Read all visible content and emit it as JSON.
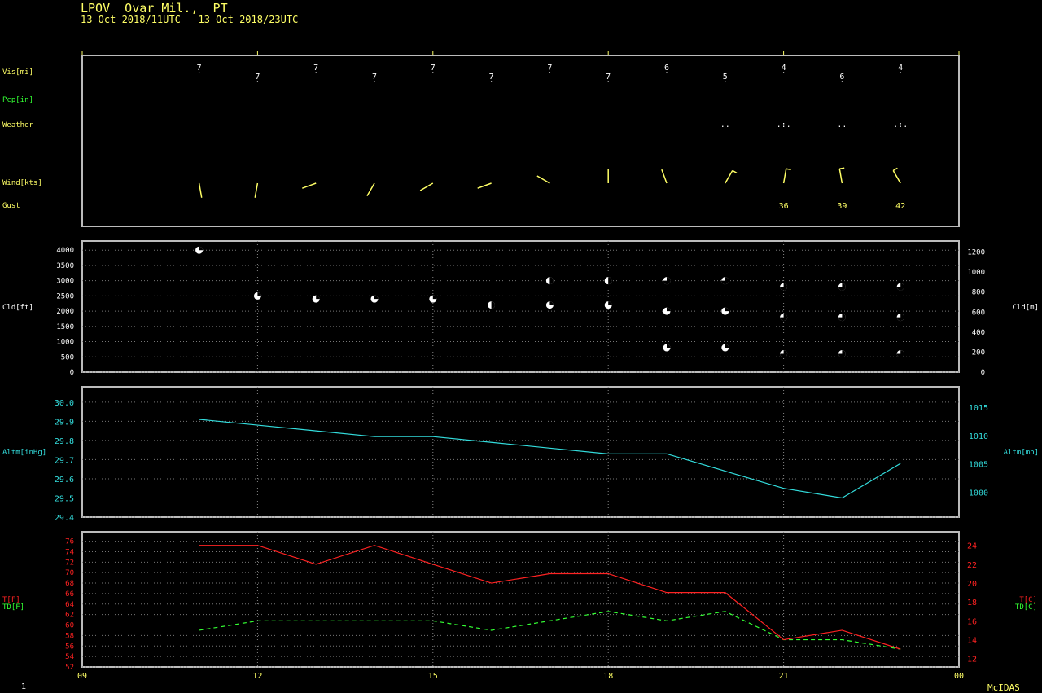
{
  "header": {
    "title": "LPOV  Ovar Mil.,  PT",
    "subtitle": "13 Oct 2018/11UTC - 13 Oct 2018/23UTC"
  },
  "footer": {
    "page_number": "1",
    "brand": "McIDAS"
  },
  "colors": {
    "yellow": "#ffff66",
    "green": "#33ff33",
    "white": "#ffffff",
    "cyan": "#33dddd",
    "red": "#ff2222",
    "frame": "#bbbbbb"
  },
  "top_panel": {
    "labels": {
      "vis": "Vis[mi]",
      "pcp": "Pcp[in]",
      "weather": "Weather",
      "wind": "Wind[kts]",
      "gust": "Gust"
    },
    "hours": [
      11,
      12,
      13,
      14,
      15,
      16,
      17,
      18,
      19,
      20,
      21,
      22,
      23
    ],
    "vis_values": [
      "7",
      "7",
      "7",
      "7",
      "7",
      "7",
      "7",
      "7",
      "6",
      "5",
      "4",
      "6",
      "4"
    ],
    "weather_symbols": [
      "",
      "",
      "",
      "",
      "",
      "",
      "",
      "",
      "",
      "..",
      ".:.",
      "..",
      ".:."
    ],
    "wind_dirs": [
      170,
      190,
      250,
      210,
      240,
      250,
      300,
      0,
      340,
      30,
      10,
      350,
      330
    ],
    "gusts": [
      "",
      "",
      "",
      "",
      "",
      "",
      "",
      "",
      "",
      "",
      "36",
      "39",
      "42"
    ]
  },
  "chart_data": [
    {
      "type": "scatter",
      "name": "cloud",
      "ylabel_left": "Cld[ft]",
      "ylabel_right": "Cld[m]",
      "ylim": [
        0,
        4300
      ],
      "yticks_left": [
        "0",
        "500",
        "1000",
        "1500",
        "2000",
        "2500",
        "3000",
        "3500",
        "4000"
      ],
      "yticks_right": [
        "0",
        "200",
        "400",
        "600",
        "800",
        "1000",
        "1200"
      ],
      "layers": [
        {
          "hour": 11,
          "ft": 4000,
          "cover": "few"
        },
        {
          "hour": 12,
          "ft": 2500,
          "cover": "few"
        },
        {
          "hour": 13,
          "ft": 2400,
          "cover": "few"
        },
        {
          "hour": 14,
          "ft": 2400,
          "cover": "few"
        },
        {
          "hour": 15,
          "ft": 2400,
          "cover": "few"
        },
        {
          "hour": 16,
          "ft": 2200,
          "cover": "sct"
        },
        {
          "hour": 17,
          "ft": 3000,
          "cover": "sct"
        },
        {
          "hour": 17,
          "ft": 2200,
          "cover": "few"
        },
        {
          "hour": 18,
          "ft": 3000,
          "cover": "sct"
        },
        {
          "hour": 18,
          "ft": 2200,
          "cover": "few"
        },
        {
          "hour": 19,
          "ft": 3000,
          "cover": "bkn"
        },
        {
          "hour": 19,
          "ft": 2000,
          "cover": "few"
        },
        {
          "hour": 19,
          "ft": 800,
          "cover": "few"
        },
        {
          "hour": 20,
          "ft": 3000,
          "cover": "bkn"
        },
        {
          "hour": 20,
          "ft": 2000,
          "cover": "few"
        },
        {
          "hour": 20,
          "ft": 800,
          "cover": "few"
        },
        {
          "hour": 21,
          "ft": 2800,
          "cover": "bkn"
        },
        {
          "hour": 21,
          "ft": 1800,
          "cover": "bkn"
        },
        {
          "hour": 21,
          "ft": 600,
          "cover": "bkn"
        },
        {
          "hour": 22,
          "ft": 2800,
          "cover": "bkn"
        },
        {
          "hour": 22,
          "ft": 1800,
          "cover": "bkn"
        },
        {
          "hour": 22,
          "ft": 600,
          "cover": "bkn"
        },
        {
          "hour": 23,
          "ft": 2800,
          "cover": "bkn"
        },
        {
          "hour": 23,
          "ft": 1800,
          "cover": "bkn"
        },
        {
          "hour": 23,
          "ft": 600,
          "cover": "bkn"
        }
      ]
    },
    {
      "type": "line",
      "name": "altimeter",
      "ylabel_left": "Altm[inHg]",
      "ylabel_right": "Altm[mb]",
      "ylim": [
        29.4,
        30.08
      ],
      "yticks_left": [
        "29.4",
        "29.5",
        "29.6",
        "29.7",
        "29.8",
        "29.9",
        "30.0"
      ],
      "yticks_right": [
        "1000",
        "1005",
        "1010",
        "1015"
      ],
      "x": [
        11,
        12,
        13,
        14,
        15,
        16,
        17,
        18,
        19,
        20,
        21,
        22,
        23
      ],
      "values": [
        29.91,
        29.88,
        29.85,
        29.82,
        29.82,
        29.79,
        29.76,
        29.73,
        29.73,
        29.64,
        29.55,
        29.5,
        29.68
      ]
    },
    {
      "type": "line",
      "name": "temperature",
      "ylabel_left_t": "T[F]",
      "ylabel_left_td": "TD[F]",
      "ylabel_right_t": "T[C]",
      "ylabel_right_td": "TD[C]",
      "ylim": [
        52,
        77.8
      ],
      "yticks_left": [
        "52",
        "54",
        "56",
        "58",
        "60",
        "62",
        "64",
        "66",
        "68",
        "70",
        "72",
        "74",
        "76"
      ],
      "yticks_right": [
        "12",
        "14",
        "16",
        "18",
        "20",
        "22",
        "24"
      ],
      "x": [
        11,
        12,
        13,
        14,
        15,
        16,
        17,
        18,
        19,
        20,
        21,
        22,
        23
      ],
      "series": [
        {
          "name": "T",
          "values": [
            75.2,
            75.2,
            71.6,
            75.2,
            71.6,
            68,
            69.8,
            69.8,
            66.2,
            66.2,
            57.2,
            59,
            55.4
          ]
        },
        {
          "name": "TD",
          "values": [
            59,
            60.8,
            60.8,
            60.8,
            60.8,
            59,
            60.8,
            62.6,
            60.8,
            62.6,
            57.2,
            57.2,
            55.4
          ]
        }
      ]
    }
  ],
  "x_axis": {
    "ticks": [
      {
        "hour": 9,
        "label": "09"
      },
      {
        "hour": 12,
        "label": "12"
      },
      {
        "hour": 15,
        "label": "15"
      },
      {
        "hour": 18,
        "label": "18"
      },
      {
        "hour": 21,
        "label": "21"
      },
      {
        "hour": 24,
        "label": "00"
      }
    ],
    "xlim": [
      9,
      24
    ]
  }
}
